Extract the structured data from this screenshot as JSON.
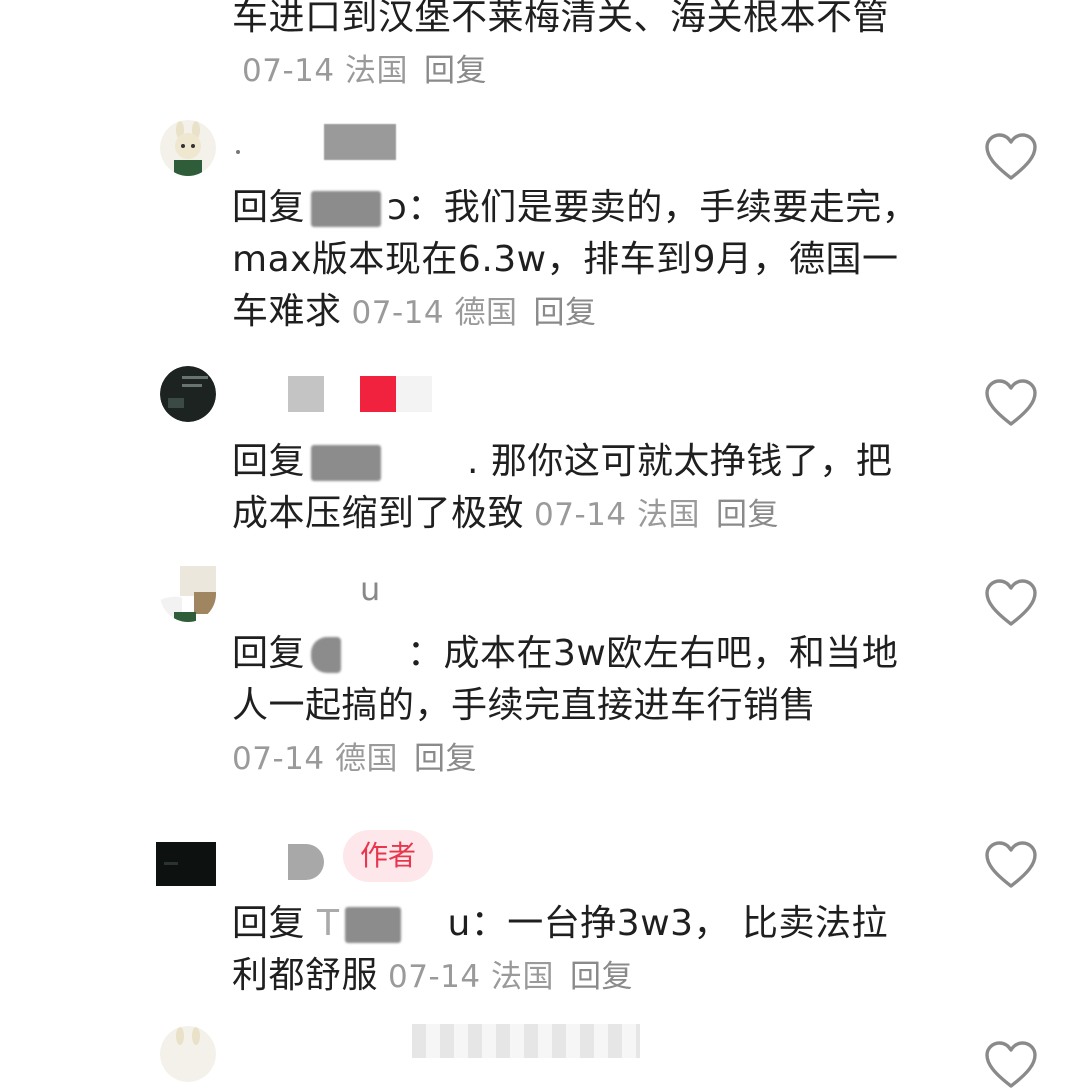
{
  "comments": [
    {
      "text_before": "车进口到汉堡不莱梅清关、海关根本不管",
      "date": "07-14",
      "location": "法国",
      "reply_label": "回复"
    },
    {
      "reply_prefix": "回复",
      "reply_target_suffix": "ɔ：",
      "text": "我们是要卖的，手续要走完，max版本现在6.3w，排车到9月，德国一车难求",
      "date": "07-14",
      "location": "德国",
      "reply_label": "回复"
    },
    {
      "reply_prefix": "回复",
      "reply_target_suffix": ".",
      "text": "那你这可就太挣钱了，把成本压缩到了极致",
      "date": "07-14",
      "location": "法国",
      "reply_label": "回复"
    },
    {
      "name_fragment": "u",
      "reply_prefix": "回复",
      "reply_target_suffix": "：",
      "text": "成本在3w欧左右吧，和当地人一起搞的，手续完直接进车行销售",
      "date": "07-14",
      "location": "德国",
      "reply_label": "回复"
    },
    {
      "author_badge": "作者",
      "reply_prefix": "回复",
      "reply_target_prefix": "T",
      "reply_target_suffix": "u：",
      "text": "一台挣3w3， 比卖法拉利都舒服",
      "date": "07-14",
      "location": "法国",
      "reply_label": "回复"
    }
  ],
  "colors": {
    "text": "#1f1f1f",
    "meta": "#9a9a9a",
    "badge_bg": "#fde7ea",
    "badge_text": "#e8364d",
    "heart": "#8a8a8a"
  },
  "icons": [
    "heart-icon",
    "avatar"
  ]
}
